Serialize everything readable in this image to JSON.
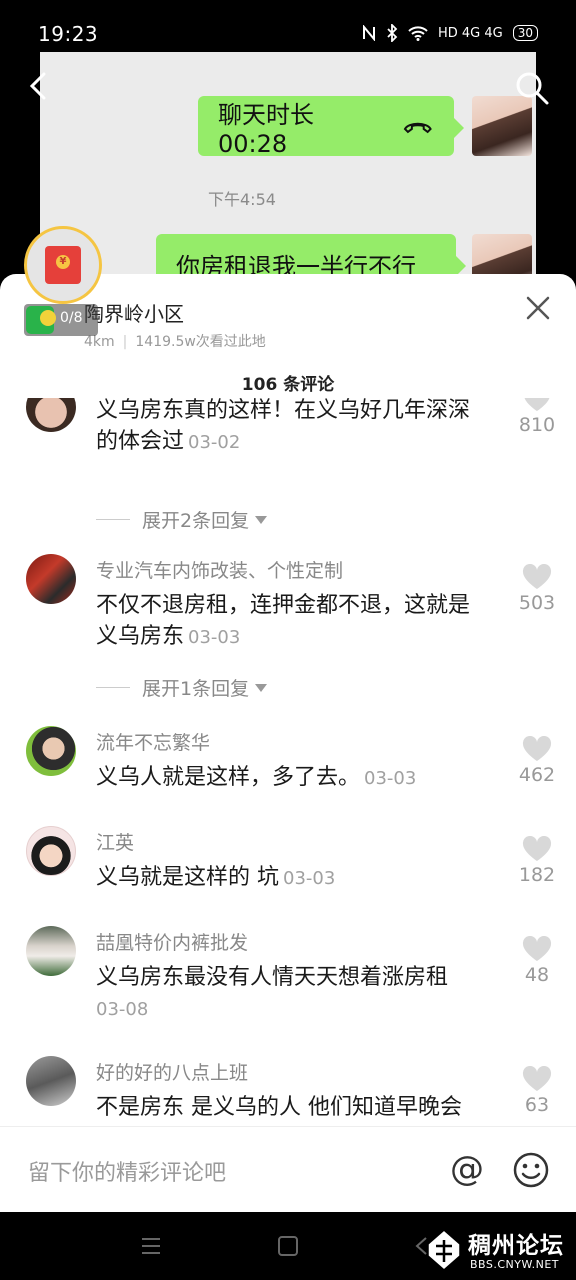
{
  "status_bar": {
    "time": "19:23",
    "network": "HD 4G 4G",
    "battery": "30"
  },
  "video": {
    "bubble1": "聊天时长 00:28",
    "time_label": "下午4:54",
    "bubble2": "你房租退我一半行不行"
  },
  "redpacket": {
    "seal": "¥",
    "progress": "0/8"
  },
  "location": {
    "name": "陶界岭小区",
    "distance": "4km",
    "views": "1419.5w次看过此地"
  },
  "comment_count": "106 条评论",
  "comments": [
    {
      "user": "",
      "text": "义乌房东真的这样！在义乌好几年深深的体会过",
      "date": "03-02",
      "likes": "810",
      "replies": "展开2条回复"
    },
    {
      "user": "专业汽车内饰改装、个性定制",
      "text": "不仅不退房租，连押金都不退，这就是义乌房东",
      "date": "03-03",
      "likes": "503",
      "replies": "展开1条回复"
    },
    {
      "user": "流年不忘繁华",
      "text": "义乌人就是这样，多了去。",
      "date": "03-03",
      "likes": "462"
    },
    {
      "user": "江英",
      "text": "义乌就是这样的 坑",
      "date": "03-03",
      "likes": "182"
    },
    {
      "user": "喆凰特价内裤批发",
      "text": "义乌房东最没有人情天天想着涨房租",
      "date": "03-08",
      "likes": "48"
    },
    {
      "user": "好的好的八点上班",
      "text": "不是房东 是义乌的人 他们知道早晚会",
      "date": "",
      "likes": "63"
    }
  ],
  "input": {
    "placeholder": "留下你的精彩评论吧",
    "at_symbol": "@"
  },
  "watermark": {
    "title": "稠州论坛",
    "url": "BBS.CNYW.NET"
  }
}
